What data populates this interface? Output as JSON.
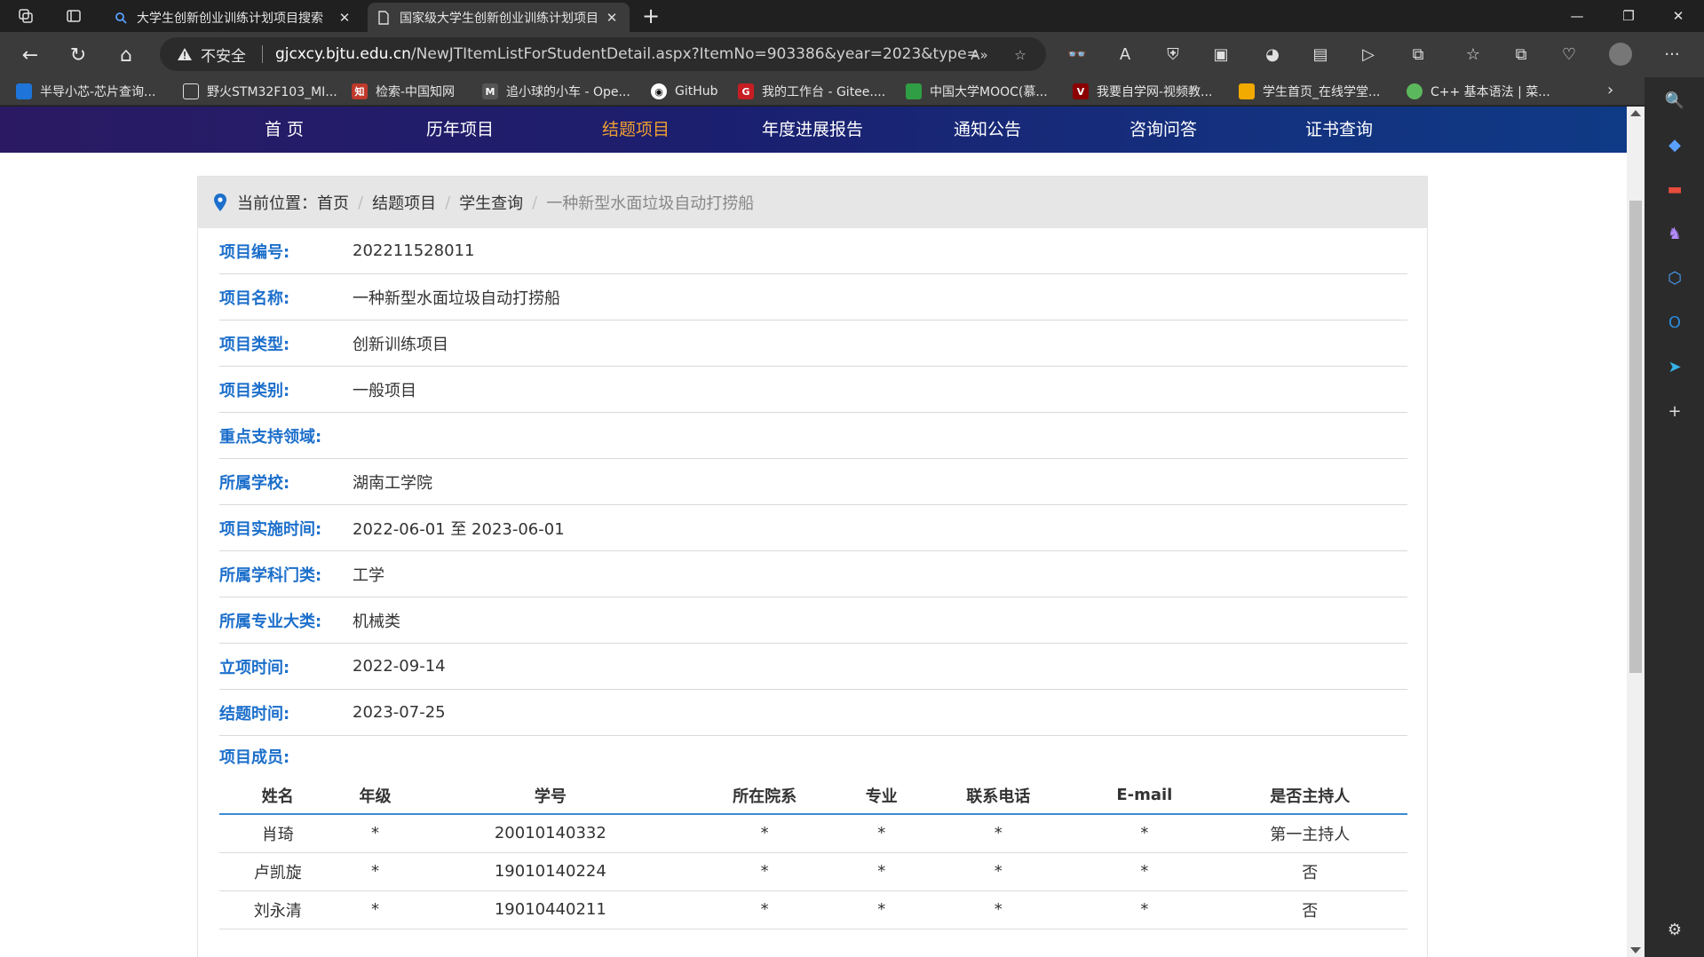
{
  "browser": {
    "tabs": [
      {
        "title": "大学生创新创业训练计划项目搜索"
      },
      {
        "title": "国家级大学生创新创业训练计划项目"
      }
    ],
    "address": {
      "insecure_label": "不安全",
      "url_host": "gjcxcy.bjtu.edu.cn",
      "url_path": "/NewJTItemListForStudentDetail.aspx?ItemNo=903386&year=2023&type=stud..."
    },
    "bookmarks": [
      {
        "label": "半导小芯-芯片查询...",
        "color": "#1e74d8"
      },
      {
        "label": "野火STM32F103_MI...",
        "color": "#e6e6e6"
      },
      {
        "label": "检索-中国知网",
        "color": "#c0392b"
      },
      {
        "label": "追小球的小车 - Ope...",
        "color": "#666666"
      },
      {
        "label": "GitHub",
        "color": "#ffffff"
      },
      {
        "label": "我的工作台 - Gitee....",
        "color": "#c71d23"
      },
      {
        "label": "中国大学MOOC(慕...",
        "color": "#2f9e44"
      },
      {
        "label": "我要自学网-视频教...",
        "color": "#8b0000"
      },
      {
        "label": "学生首页_在线学堂...",
        "color": "#f2a900"
      },
      {
        "label": "C++ 基本语法 | 菜...",
        "color": "#5cb85c"
      }
    ]
  },
  "site": {
    "nav": [
      {
        "label": "首 页"
      },
      {
        "label": "历年项目"
      },
      {
        "label": "结题项目"
      },
      {
        "label": "年度进展报告"
      },
      {
        "label": "通知公告"
      },
      {
        "label": "咨询问答"
      },
      {
        "label": "证书查询"
      }
    ],
    "breadcrumb": {
      "prefix": "当前位置：",
      "items": [
        "首页",
        "结题项目",
        "学生查询",
        "一种新型水面垃圾自动打捞船"
      ]
    },
    "fields": [
      {
        "label": "项目编号:",
        "value": "202211528011"
      },
      {
        "label": "项目名称:",
        "value": "一种新型水面垃圾自动打捞船"
      },
      {
        "label": "项目类型:",
        "value": "创新训练项目"
      },
      {
        "label": "项目类别:",
        "value": "一般项目"
      },
      {
        "label": "重点支持领域:",
        "value": ""
      },
      {
        "label": "所属学校:",
        "value": "湖南工学院"
      },
      {
        "label": "项目实施时间:",
        "value": "2022-06-01 至 2023-06-01"
      },
      {
        "label": "所属学科门类:",
        "value": "工学"
      },
      {
        "label": "所属专业大类:",
        "value": "机械类"
      },
      {
        "label": "立项时间:",
        "value": "2022-09-14"
      },
      {
        "label": "结题时间:",
        "value": "2023-07-25"
      }
    ],
    "members_title": "项目成员:",
    "members_columns": [
      "姓名",
      "年级",
      "学号",
      "所在院系",
      "专业",
      "联系电话",
      "E-mail",
      "是否主持人"
    ],
    "members_rows": [
      [
        "肖琦",
        "*",
        "20010140332",
        "*",
        "*",
        "*",
        "*",
        "第一主持人"
      ],
      [
        "卢凯旋",
        "*",
        "19010140224",
        "*",
        "*",
        "*",
        "*",
        "否"
      ],
      [
        "刘永清",
        "*",
        "19010440211",
        "*",
        "*",
        "*",
        "*",
        "否"
      ]
    ]
  },
  "colors": {
    "accent_blue": "#1c6fcb",
    "nav_current": "#f0a030"
  }
}
